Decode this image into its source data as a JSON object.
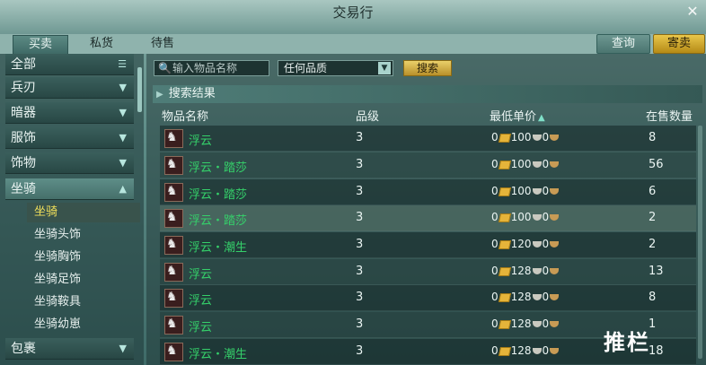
{
  "window": {
    "title": "交易行",
    "close_glyph": "✕"
  },
  "tabs": [
    {
      "label": "买卖",
      "active": true
    },
    {
      "label": "私货",
      "active": false
    },
    {
      "label": "待售",
      "active": false
    }
  ],
  "top_buttons": {
    "query": "查询",
    "sell": "寄卖"
  },
  "sidebar": {
    "categories": [
      {
        "label": "全部",
        "icon": "list-icon"
      },
      {
        "label": "兵刃",
        "icon": "chevron-down-icon"
      },
      {
        "label": "暗器",
        "icon": "chevron-down-icon"
      },
      {
        "label": "服饰",
        "icon": "chevron-down-icon"
      },
      {
        "label": "饰物",
        "icon": "chevron-down-icon"
      },
      {
        "label": "坐骑",
        "icon": "chevron-up-icon"
      },
      {
        "label": "包裹",
        "icon": "chevron-down-icon"
      }
    ],
    "subitems": [
      {
        "label": "坐骑",
        "active": true
      },
      {
        "label": "坐骑头饰",
        "active": false
      },
      {
        "label": "坐骑胸饰",
        "active": false
      },
      {
        "label": "坐骑足饰",
        "active": false
      },
      {
        "label": "坐骑鞍具",
        "active": false
      },
      {
        "label": "坐骑幼崽",
        "active": false
      }
    ]
  },
  "search": {
    "placeholder": "输入物品名称",
    "quality": "任何品质",
    "button": "搜索"
  },
  "results": {
    "heading": "搜索结果",
    "columns": {
      "name": "物品名称",
      "level": "品级",
      "price": "最低单价",
      "qty": "在售数量"
    },
    "rows": [
      {
        "name": "浮云",
        "level": "3",
        "gold": "0",
        "silver": "100",
        "copper": "0",
        "qty": "8"
      },
      {
        "name": "浮云・踏莎",
        "level": "3",
        "gold": "0",
        "silver": "100",
        "copper": "0",
        "qty": "56"
      },
      {
        "name": "浮云・踏莎",
        "level": "3",
        "gold": "0",
        "silver": "100",
        "copper": "0",
        "qty": "6"
      },
      {
        "name": "浮云・踏莎",
        "level": "3",
        "gold": "0",
        "silver": "100",
        "copper": "0",
        "qty": "2"
      },
      {
        "name": "浮云・潮生",
        "level": "3",
        "gold": "0",
        "silver": "120",
        "copper": "0",
        "qty": "2"
      },
      {
        "name": "浮云",
        "level": "3",
        "gold": "0",
        "silver": "128",
        "copper": "0",
        "qty": "13"
      },
      {
        "name": "浮云",
        "level": "3",
        "gold": "0",
        "silver": "128",
        "copper": "0",
        "qty": "8"
      },
      {
        "name": "浮云",
        "level": "3",
        "gold": "0",
        "silver": "128",
        "copper": "0",
        "qty": "1"
      },
      {
        "name": "浮云・潮生",
        "level": "3",
        "gold": "0",
        "silver": "128",
        "copper": "0",
        "qty": "18"
      }
    ]
  },
  "watermark": "推栏"
}
